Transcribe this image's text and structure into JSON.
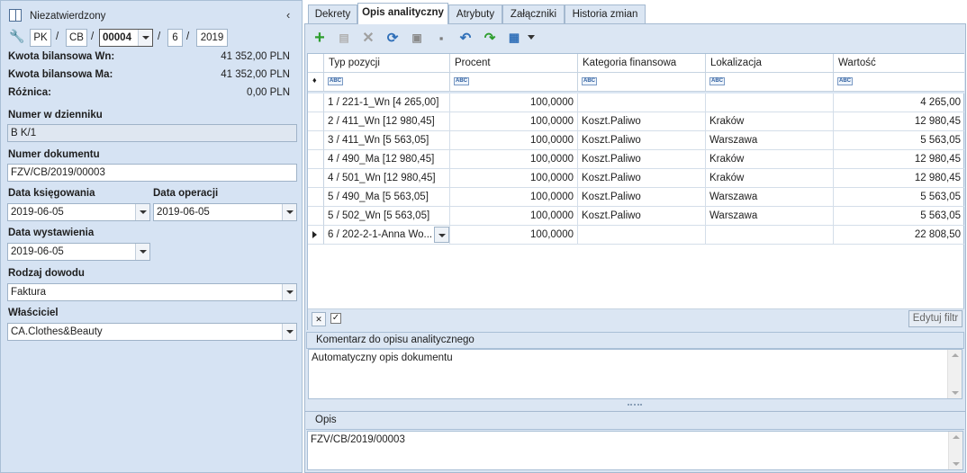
{
  "left": {
    "status": "Niezatwierdzony",
    "docnum": {
      "p1": "PK",
      "sep": "/",
      "p2": "CB",
      "p3": "00004",
      "p4": "6",
      "p5": "2019"
    },
    "saldo": [
      {
        "label": "Kwota bilansowa Wn:",
        "value": "41 352,00 PLN"
      },
      {
        "label": "Kwota bilansowa Ma:",
        "value": "41 352,00 PLN"
      },
      {
        "label": "Różnica:",
        "value": "0,00 PLN"
      }
    ],
    "journal_label": "Numer w dzienniku",
    "journal_value": "B K/1",
    "docnr_label": "Numer dokumentu",
    "docnr_value": "FZV/CB/2019/00003",
    "book_date_label": "Data księgowania",
    "book_date_value": "2019-06-05",
    "op_date_label": "Data operacji",
    "op_date_value": "2019-06-05",
    "issue_date_label": "Data wystawienia",
    "issue_date_value": "2019-06-05",
    "proof_label": "Rodzaj dowodu",
    "proof_value": "Faktura",
    "owner_label": "Właściciel",
    "owner_value": "CA.Clothes&Beauty"
  },
  "tabs": [
    "Dekrety",
    "Opis analityczny",
    "Atrybuty",
    "Załączniki",
    "Historia zmian"
  ],
  "grid": {
    "columns": [
      "Typ pozycji",
      "Procent",
      "Kategoria finansowa",
      "Lokalizacja",
      "Wartość"
    ],
    "filter_tag": "ABC",
    "rows": [
      [
        "1 / 221-1_Wn [4 265,00]",
        "100,0000",
        "",
        "",
        "4 265,00"
      ],
      [
        "2 / 411_Wn [12 980,45]",
        "100,0000",
        "Koszt.Paliwo",
        "Kraków",
        "12 980,45"
      ],
      [
        "3 / 411_Wn [5 563,05]",
        "100,0000",
        "Koszt.Paliwo",
        "Warszawa",
        "5 563,05"
      ],
      [
        "4 / 490_Ma [12 980,45]",
        "100,0000",
        "Koszt.Paliwo",
        "Kraków",
        "12 980,45"
      ],
      [
        "4 / 501_Wn [12 980,45]",
        "100,0000",
        "Koszt.Paliwo",
        "Kraków",
        "12 980,45"
      ],
      [
        "5 / 490_Ma [5 563,05]",
        "100,0000",
        "Koszt.Paliwo",
        "Warszawa",
        "5 563,05"
      ],
      [
        "5 / 502_Wn [5 563,05]",
        "100,0000",
        "Koszt.Paliwo",
        "Warszawa",
        "5 563,05"
      ],
      [
        "6 / 202-2-1-Anna Wo...",
        "100,0000",
        "",
        "",
        "22 808,50"
      ]
    ],
    "edit_filter": "Edytuj filtr"
  },
  "comment": {
    "title": "Komentarz do opisu analitycznego",
    "text": "Automatyczny opis dokumentu"
  },
  "desc": {
    "title": "Opis",
    "text": "FZV/CB/2019/00003"
  },
  "colors": {
    "panel": "#d6e3f3",
    "add": "#2e9e2e",
    "blue": "#2f6fb8"
  }
}
